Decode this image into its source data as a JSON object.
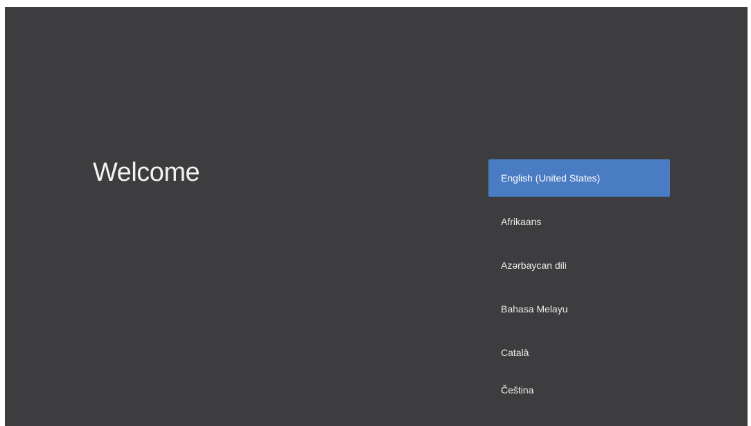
{
  "welcome": {
    "title": "Welcome"
  },
  "languages": {
    "selected_index": 0,
    "items": [
      "English (United States)",
      "Afrikaans",
      "Azərbaycan dili",
      "Bahasa Melayu",
      "Català",
      "Čeština"
    ]
  },
  "colors": {
    "background": "#3d3d3f",
    "selected_highlight": "#4a7cc4",
    "text": "#ececec"
  }
}
